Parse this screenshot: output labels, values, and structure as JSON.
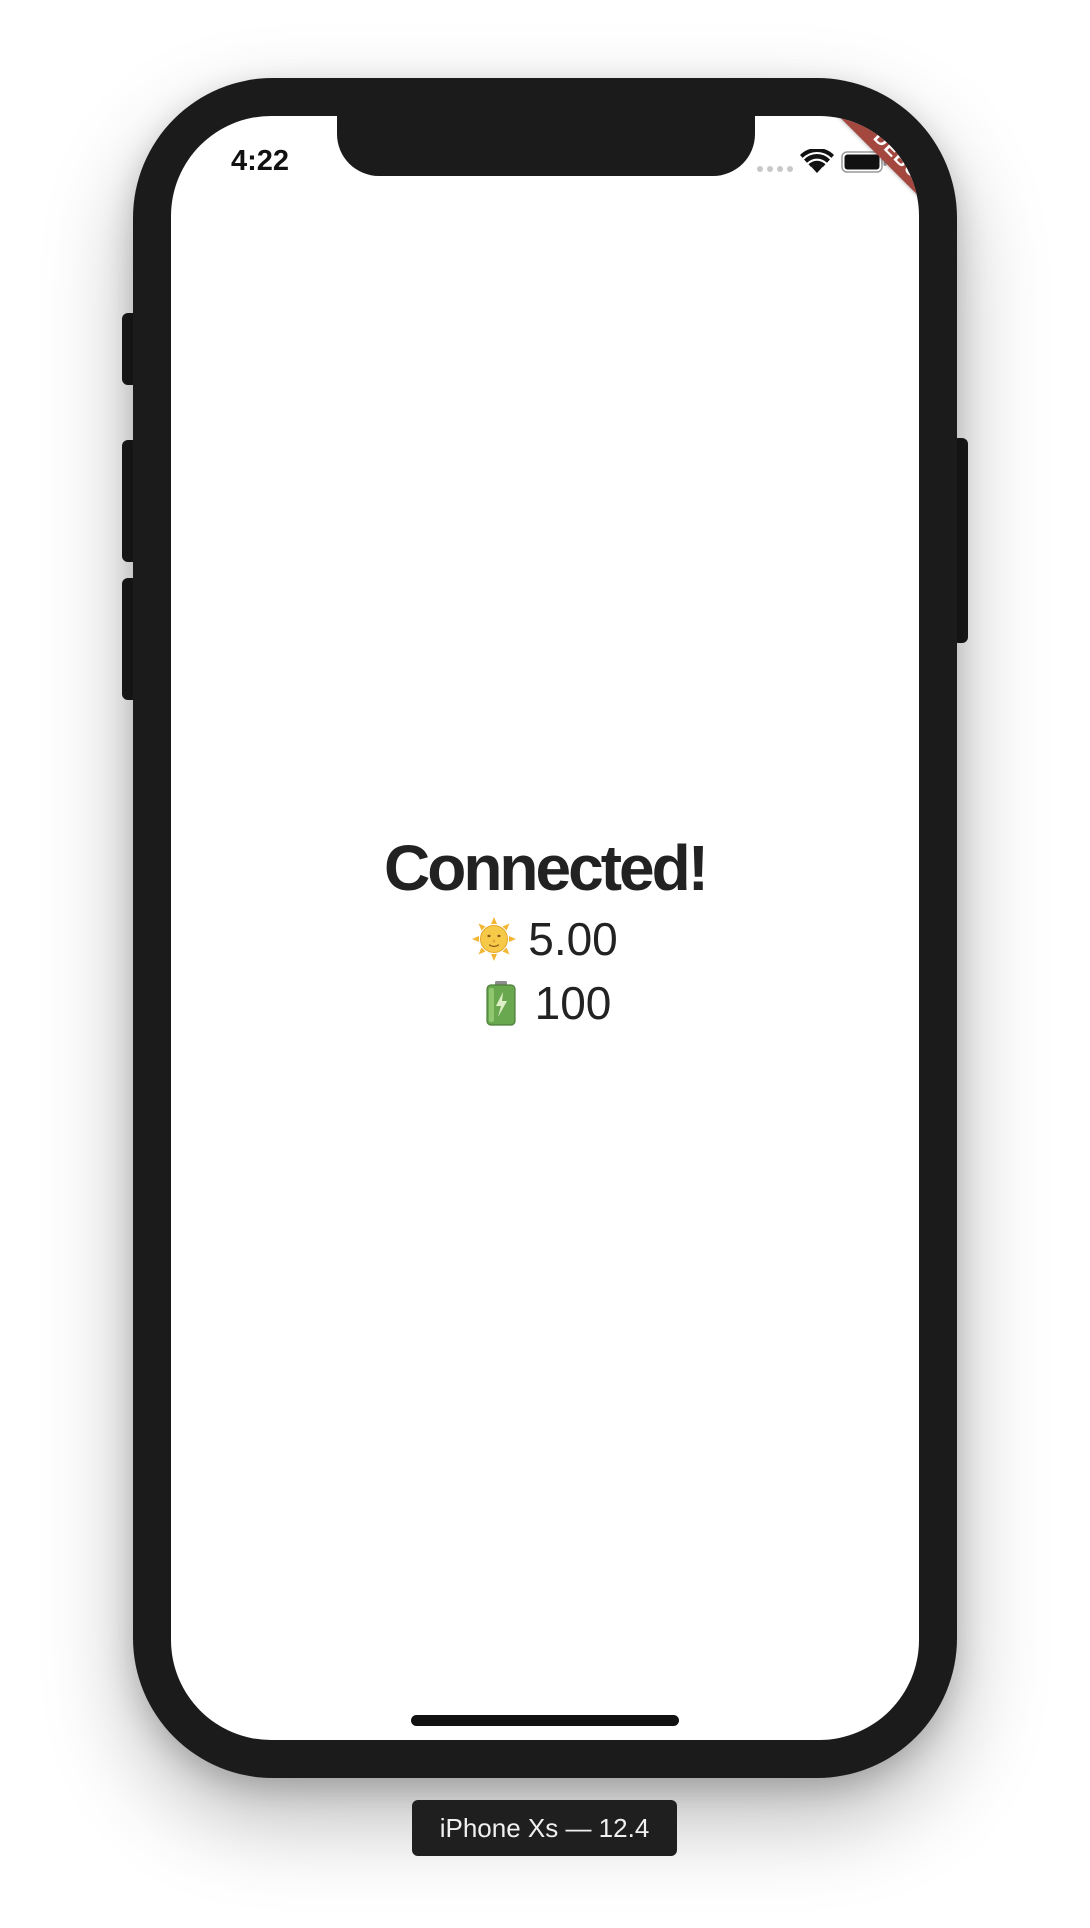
{
  "status_bar": {
    "time": "4:22"
  },
  "debug_banner": {
    "label": "DEBUG"
  },
  "main": {
    "title": "Connected!",
    "readings": [
      {
        "icon": "sun-icon",
        "value": "5.00"
      },
      {
        "icon": "battery-icon",
        "value": "100"
      }
    ]
  },
  "device_label": "iPhone Xs — 12.4",
  "colors": {
    "device_frame": "#1b1b1b",
    "screen_background": "#ffffff",
    "debug_banner": "#a4473f",
    "text": "#222222",
    "battery_green": "#6aa84f",
    "sun_yellow": "#f4c542"
  }
}
